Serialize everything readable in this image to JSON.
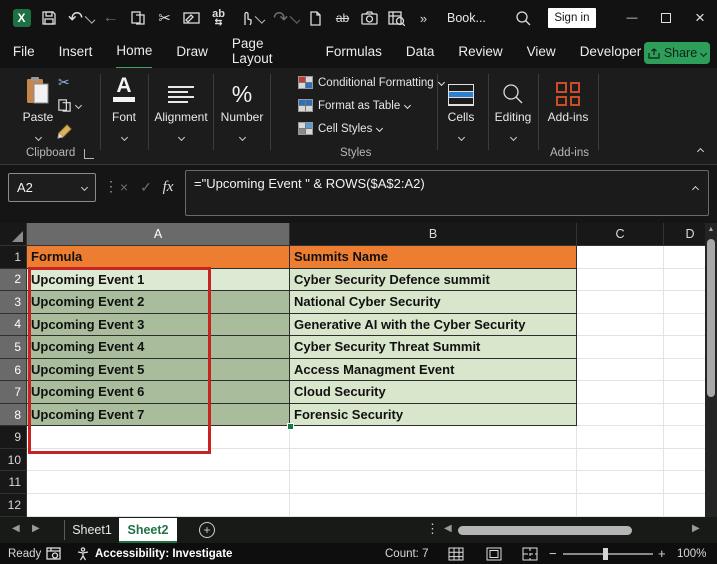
{
  "colors": {
    "accent-green": "#217346",
    "tab-underline": "#3fa368",
    "share-green": "#2e9e5b",
    "orange-fill": "#ED7D31",
    "green-fill": "#D8E6CC",
    "green-fill-selected": "#A9BD9C",
    "green-fill-active": "#DCE9D3",
    "red-annotation": "#C52421",
    "addins-orange": "#C74E26"
  },
  "titlebar": {
    "workbook_title": "Book...",
    "sign_in_label": "Sign in",
    "more_commands_glyph": "»",
    "undo_glyph": "↶",
    "redo_glyph": "↷",
    "back_glyph": "←",
    "cut_glyph": "✂",
    "replace_glyph": "ab",
    "strike_glyph": "ab",
    "minimize_glyph": "—",
    "close_glyph": "×"
  },
  "tabs": {
    "active": "Home",
    "items": [
      {
        "label": "File"
      },
      {
        "label": "Insert"
      },
      {
        "label": "Home"
      },
      {
        "label": "Draw"
      },
      {
        "label": "Page Layout"
      },
      {
        "label": "Formulas"
      },
      {
        "label": "Data"
      },
      {
        "label": "Review"
      },
      {
        "label": "View"
      },
      {
        "label": "Developer"
      },
      {
        "label": "Help"
      }
    ]
  },
  "share_label": "Share",
  "ribbon": {
    "paste_label": "Paste",
    "font_label": "Font",
    "alignment_label": "Alignment",
    "number_label": "Number",
    "number_glyph": "%",
    "cells_label": "Cells",
    "editing_label": "Editing",
    "addins_label": "Add-ins",
    "styles_items": [
      {
        "label": "Conditional Formatting"
      },
      {
        "label": "Format as Table"
      },
      {
        "label": "Cell Styles"
      }
    ],
    "group_labels": {
      "clipboard": "Clipboard",
      "styles": "Styles",
      "addins": "Add-ins"
    }
  },
  "formula_bar": {
    "name_box_value": "A2",
    "cancel_glyph": "×",
    "enter_glyph": "✓",
    "fx_label": "fx",
    "formula": "=\"Upcoming Event \" & ROWS($A$2:A2)"
  },
  "grid": {
    "col_headers": [
      "A",
      "B",
      "C",
      "D"
    ],
    "active_cell": "A2",
    "selection": "A2:A8",
    "rows": [
      {
        "n": "1",
        "a": "Formula",
        "b": "Summits Name"
      },
      {
        "n": "2",
        "a": "Upcoming Event 1",
        "b": "Cyber Security Defence summit"
      },
      {
        "n": "3",
        "a": "Upcoming Event 2",
        "b": "National Cyber Security"
      },
      {
        "n": "4",
        "a": "Upcoming Event 3",
        "b": "Generative AI with the Cyber Security"
      },
      {
        "n": "5",
        "a": "Upcoming Event 4",
        "b": "Cyber Security  Threat Summit"
      },
      {
        "n": "6",
        "a": "Upcoming Event 5",
        "b": "Access Managment Event"
      },
      {
        "n": "7",
        "a": "Upcoming Event 6",
        "b": "Cloud Security"
      },
      {
        "n": "8",
        "a": "Upcoming Event 7",
        "b": "Forensic Security"
      },
      {
        "n": "9",
        "a": "",
        "b": ""
      },
      {
        "n": "10",
        "a": "",
        "b": ""
      },
      {
        "n": "11",
        "a": "",
        "b": ""
      },
      {
        "n": "12",
        "a": "",
        "b": ""
      }
    ]
  },
  "sheet_bar": {
    "active": "Sheet2",
    "tabs": [
      {
        "label": "Sheet1"
      },
      {
        "label": "Sheet2"
      }
    ],
    "add_glyph": "+"
  },
  "status_bar": {
    "ready_label": "Ready",
    "accessibility_label": "Accessibility: Investigate",
    "count_label": "Count: 7",
    "zoom_label": "100%",
    "zoom_minus": "−",
    "zoom_plus": "+"
  }
}
